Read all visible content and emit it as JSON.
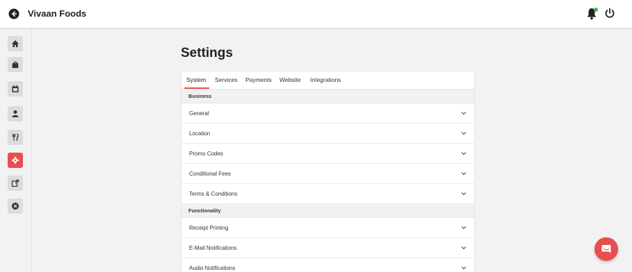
{
  "header": {
    "app_title": "Vivaan Foods",
    "back_icon": "arrow-left-circle-icon",
    "bell_icon": "bell-icon",
    "power_icon": "power-icon",
    "status_dot_color": "#4caf50"
  },
  "sidebar": {
    "items": [
      {
        "icon": "home-icon",
        "active": false
      },
      {
        "icon": "shopping-bag-icon",
        "active": false
      },
      {
        "icon": "calendar-icon",
        "active": false
      },
      {
        "icon": "user-icon",
        "active": false
      },
      {
        "icon": "cutlery-icon",
        "active": false
      },
      {
        "icon": "gear-icon",
        "active": true
      },
      {
        "icon": "external-link-icon",
        "active": false
      },
      {
        "icon": "close-circle-icon",
        "active": false
      }
    ],
    "active_color": "#e94e4e"
  },
  "page": {
    "title": "Settings"
  },
  "tabs": [
    {
      "label": "System",
      "active": true
    },
    {
      "label": "Services",
      "active": false
    },
    {
      "label": "Payments",
      "active": false
    },
    {
      "label": "Website",
      "active": false
    },
    {
      "label": "Integrations",
      "active": false
    }
  ],
  "sections": [
    {
      "label": "Business",
      "rows": [
        "General",
        "Location",
        "Promo Codes",
        "Conditional Fees",
        "Terms & Conditions"
      ]
    },
    {
      "label": "Functionality",
      "rows": [
        "Receipt Printing",
        "E-Mail Notifications",
        "Audio Notifications"
      ]
    }
  ],
  "chat": {
    "icon": "chat-icon",
    "color": "#e94e4e"
  }
}
